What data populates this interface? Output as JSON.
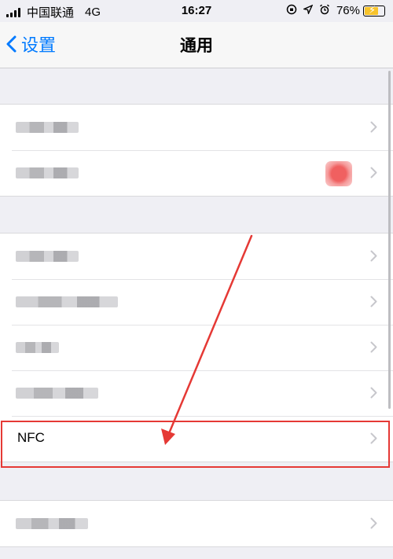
{
  "status_bar": {
    "carrier": "中国联通",
    "network": "4G",
    "time": "16:27",
    "battery": "76%",
    "battery_level": 0.76,
    "icons": [
      "signal-icon",
      "rotation-lock-icon",
      "location-icon",
      "alarm-icon",
      "battery-charging-icon"
    ]
  },
  "nav": {
    "back_label": "设置",
    "title": "通用"
  },
  "groups": [
    {
      "rows": [
        {
          "label": "",
          "accessory": "chevron"
        },
        {
          "label": "",
          "accessory": "badge"
        }
      ]
    },
    {
      "rows": [
        {
          "label": "",
          "accessory": "chevron"
        },
        {
          "label": "",
          "accessory": "chevron"
        },
        {
          "label": "",
          "accessory": "chevron"
        },
        {
          "label": "",
          "accessory": "chevron"
        },
        {
          "label": "NFC",
          "accessory": "chevron"
        }
      ]
    },
    {
      "rows": [
        {
          "label": "",
          "accessory": "chevron"
        }
      ]
    }
  ],
  "colors": {
    "accent": "#007aff",
    "annotation": "#e53935",
    "background": "#efeff4"
  }
}
